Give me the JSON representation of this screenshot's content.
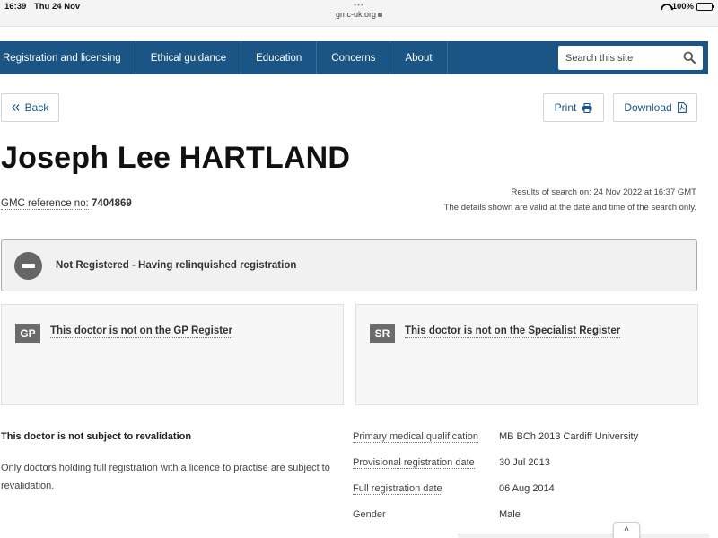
{
  "statusbar": {
    "time": "16:39",
    "date": "Thu 24 Nov",
    "dots": "•••",
    "url": "gmc-uk.org",
    "battery": "100%"
  },
  "nav": {
    "items": [
      "Registration and licensing",
      "Ethical guidance",
      "Education",
      "Concerns",
      "About"
    ],
    "search_placeholder": "Search this site"
  },
  "toolbar": {
    "back_label": "Back",
    "print_label": "Print",
    "download_label": "Download"
  },
  "doctor": {
    "name": "Joseph Lee HARTLAND",
    "gmc_ref_label": "GMC reference no:",
    "gmc_ref_value": "7404869"
  },
  "search_info": {
    "line1": "Results of search on: 24 Nov 2022 at 16:37 GMT",
    "line2": "The details shown are valid at the date and time of the search only."
  },
  "status": {
    "text": "Not Registered - Having relinquished registration"
  },
  "registers": {
    "gp": {
      "badge": "GP",
      "text": "This doctor is not on the GP Register"
    },
    "sr": {
      "badge": "SR",
      "text": "This doctor is not on the Specialist Register"
    }
  },
  "revalidation": {
    "title": "This doctor is not subject to revalidation",
    "description": "Only doctors holding full registration with a licence to practise are subject to revalidation."
  },
  "details": [
    {
      "label": "Primary medical qualification",
      "value": "MB BCh 2013 Cardiff University"
    },
    {
      "label": "Provisional registration date",
      "value": "30 Jul 2013"
    },
    {
      "label": "Full registration date",
      "value": "06 Aug 2014"
    },
    {
      "label": "Gender",
      "value": "Male"
    }
  ],
  "colors": {
    "nav_bg": "#1a5585",
    "link": "#1a5585",
    "status_icon": "#666666"
  }
}
